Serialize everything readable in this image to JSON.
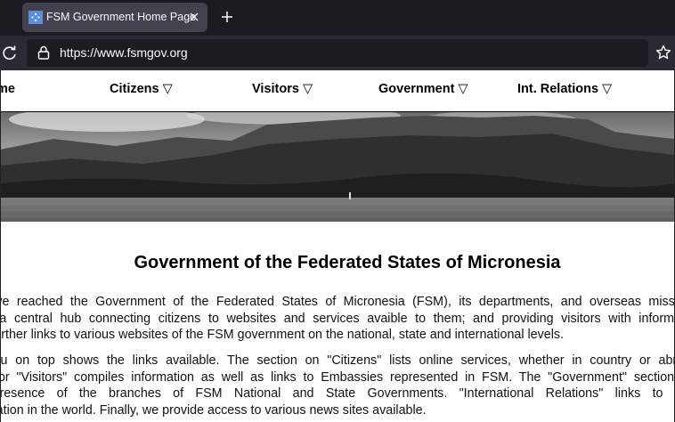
{
  "browser": {
    "tab_title": "FSM Government Home Page",
    "url": "https://www.fsmgov.org"
  },
  "nav": {
    "items": [
      {
        "label": "me"
      },
      {
        "label": "Citizens",
        "arrow": "▽"
      },
      {
        "label": "Visitors",
        "arrow": "▽"
      },
      {
        "label": "Government",
        "arrow": "▽"
      },
      {
        "label": "Int. Relations",
        "arrow": "▽"
      }
    ]
  },
  "content": {
    "title": "Government of the Federated States of Micronesia",
    "paragraph1": [
      "you have reached the Government of the Federated States of Micronesia (FSM), its departments, and overseas missions.",
      "age is a central hub connecting citizens to websites and services avaible to them; and providing visitors with information",
      "SM. It further links to various websites of the FSM government on the national, state and international levels."
    ],
    "paragraph2": [
      "he menu on top shows the links available. The section on \"Citizens\" lists online services, whether in country or abroad.",
      "ection for \"Visitors\" compiles information as well as links to Embassies represented in FSM. The \"Government\" section has",
      "nline presence of the branches of FSM National and State Governments. \"International Relations\" links to FSM",
      "presentation in the world. Finally, we provide access to various news sites available."
    ]
  }
}
